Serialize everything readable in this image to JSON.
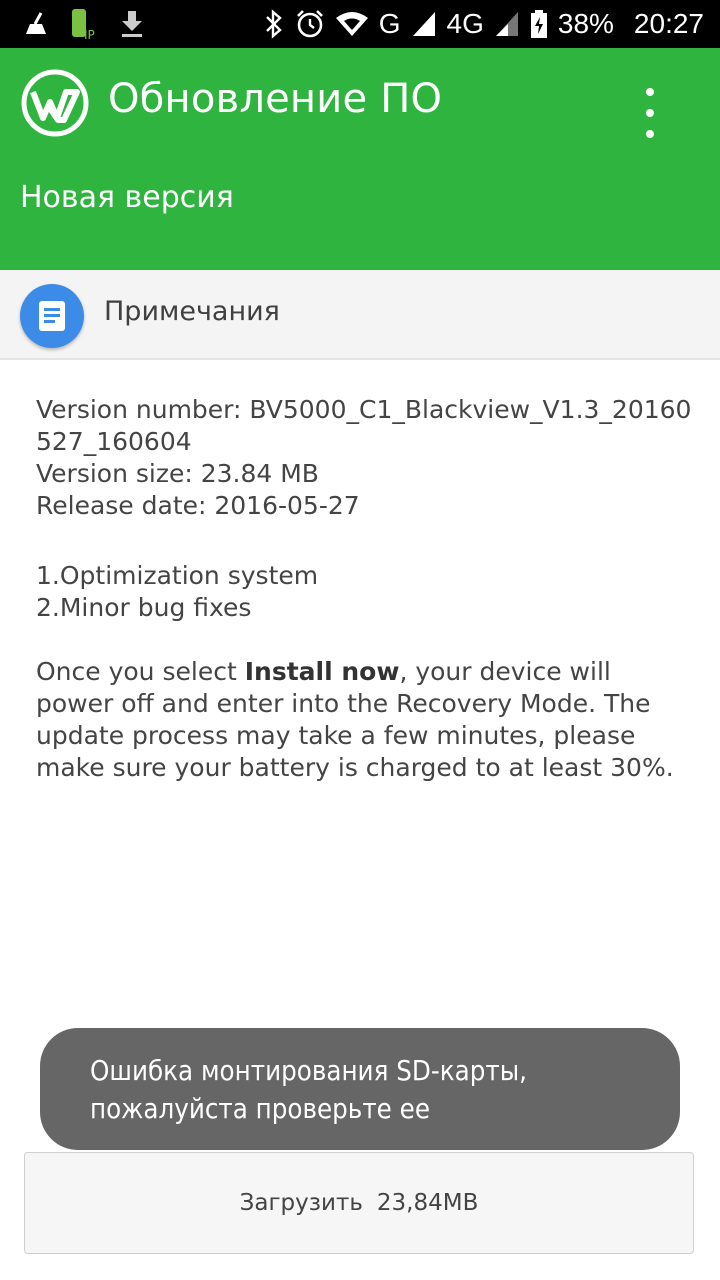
{
  "status_bar": {
    "network": "G",
    "network_4g": "4G",
    "battery": "38%",
    "time": "20:27"
  },
  "app_bar": {
    "title": "Обновление ПО",
    "subtitle": "Новая версия",
    "accent_color": "#2fb53f"
  },
  "notes": {
    "title": "Примечания",
    "icon": "document-icon"
  },
  "details": {
    "version_number": "Version number: BV5000_C1_Blackview_V1.3_20160527_160604",
    "version_size": "Version size: 23.84 MB",
    "release_date": "Release date: 2016-05-27",
    "changes": [
      "1.Optimization system",
      "2.Minor bug fixes"
    ],
    "install_prefix": "Once you select ",
    "install_bold": "Install now",
    "install_suffix": ", your device will power off and enter into the Recovery Mode. The update process may take a few minutes, please make sure your battery is charged to at least 30%."
  },
  "toast": {
    "message": "Ошибка монтирования SD-карты, пожалуйста проверьте ее"
  },
  "download": {
    "label": "Загрузить",
    "size": "23,84MB"
  }
}
